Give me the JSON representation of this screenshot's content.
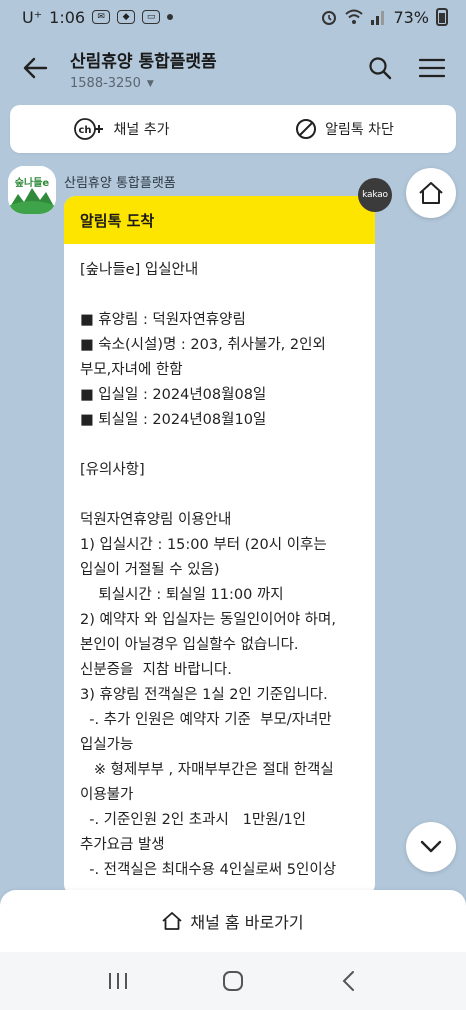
{
  "status": {
    "carrier": "U⁺",
    "time": "1:06",
    "battery": "73%"
  },
  "header": {
    "title": "산림휴양 통합플랫폼",
    "subtitle": "1588-3250"
  },
  "channel_bar": {
    "add_label": "채널 추가",
    "block_label": "알림톡 차단"
  },
  "message": {
    "sender": "산림휴양 통합플랫폼",
    "avatar_logo": "숲나들e",
    "badge": "kakao",
    "header": "알림톡 도착",
    "lines": [
      "[숲나들e] 입실안내",
      "",
      "■ 휴양림 : 덕원자연휴양림",
      "■ 숙소(시설)명 : 203, 취사불가, 2인외",
      "부모,자녀에 한함",
      "■ 입실일 : 2024년08월08일",
      "■ 퇴실일 : 2024년08월10일",
      "",
      "[유의사항]",
      "",
      "덕원자연휴양림 이용안내",
      "1) 입실시간 : 15:00 부터 (20시 이후는",
      "입실이 거절될 수 있음)",
      "    퇴실시간 : 퇴실일 11:00 까지",
      "2) 예약자 와 입실자는 동일인이어야 하며,",
      "본인이 아닐경우 입실할수 없습니다.",
      "신분증을  지참 바랍니다.",
      "3) 휴양림 전객실은 1실 2인 기준입니다.",
      "  -. 추가 인원은 예약자 기준  부모/자녀만",
      "입실가능",
      "   ※ 형제부부 , 자매부부간은 절대 한객실",
      "이용불가",
      "  -. 기준인원 2인 초과시   1만원/1인",
      "추가요금 발생",
      "  -. 전객실은 최대수용 4인실로써 5인이상"
    ]
  },
  "bottom": {
    "home_label": "채널 홈 바로가기"
  }
}
